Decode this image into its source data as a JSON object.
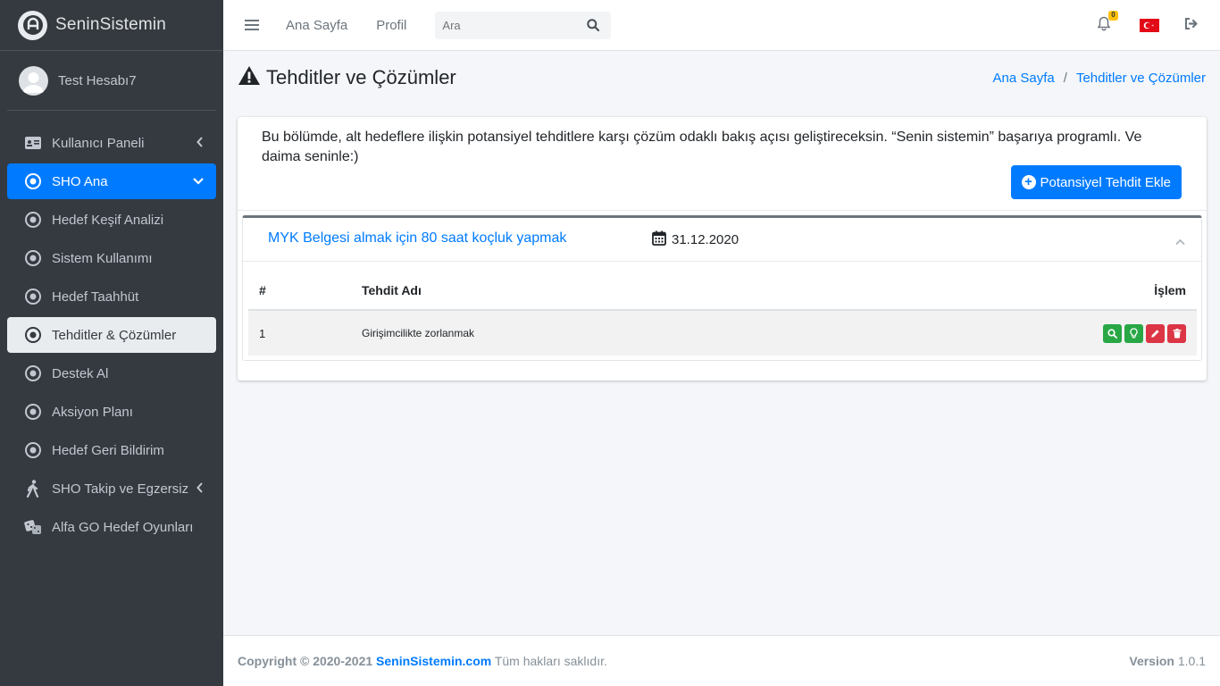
{
  "brand": {
    "name": "SeninSistemin"
  },
  "user": {
    "name": "Test Hesabı7"
  },
  "sidebar": {
    "items": [
      {
        "label": "Kullanıcı Paneli"
      },
      {
        "label": "SHO Ana"
      },
      {
        "label": "Hedef Keşif Analizi"
      },
      {
        "label": "Sistem Kullanımı"
      },
      {
        "label": "Hedef Taahhüt"
      },
      {
        "label": "Tehditler & Çözümler"
      },
      {
        "label": "Destek Al"
      },
      {
        "label": "Aksiyon Planı"
      },
      {
        "label": "Hedef Geri Bildirim"
      },
      {
        "label": "SHO Takip ve Egzersiz"
      },
      {
        "label": "Alfa GO Hedef Oyunları"
      }
    ]
  },
  "topbar": {
    "links": [
      {
        "label": "Ana Sayfa"
      },
      {
        "label": "Profil"
      }
    ],
    "search_placeholder": "Ara",
    "notification_count": "0"
  },
  "page": {
    "title": "Tehditler ve Çözümler",
    "breadcrumb": [
      {
        "label": "Ana Sayfa"
      },
      {
        "label": "Tehditler ve Çözümler"
      }
    ],
    "breadcrumb_sep": "/",
    "intro": "Bu bölümde, alt hedeflere ilişkin potansiyel tehditlere karşı çözüm odaklı bakış açısı geliştireceksin. “Senin sistemin” başarıya programlı. Ve daima seninle:)",
    "add_button": "Potansiyel Tehdit Ekle"
  },
  "goal": {
    "title": "MYK Belgesi almak için 80 saat koçluk yapmak",
    "date": "31.12.2020"
  },
  "table": {
    "headers": {
      "num": "#",
      "name": "Tehdit Adı",
      "action": "İşlem"
    },
    "rows": [
      {
        "num": "1",
        "name": "Girişimcilikte zorlanmak"
      }
    ]
  },
  "footer": {
    "copyright_prefix": "Copyright © 2020-2021",
    "site": "SeninSistemin.com",
    "rights": "Tüm hakları saklıdır.",
    "version_label": "Version",
    "version": "1.0.1"
  },
  "colors": {
    "primary": "#007bff",
    "sidebar": "#343a40",
    "success": "#28a745",
    "danger": "#dc3545",
    "badge": "#ffc107"
  }
}
